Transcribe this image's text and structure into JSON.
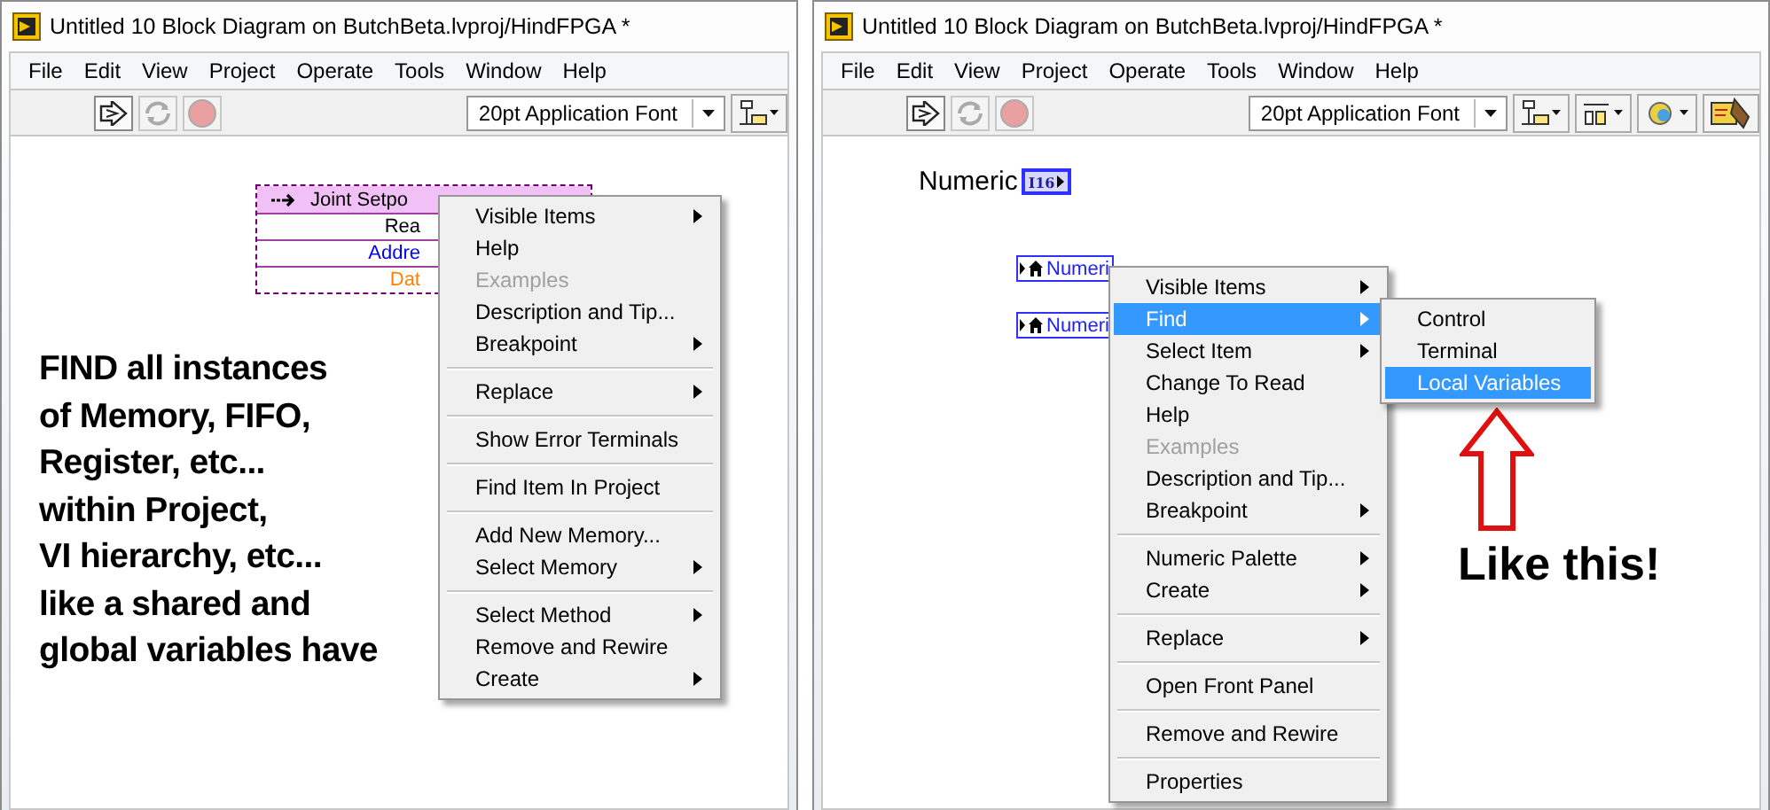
{
  "windows": [
    {
      "title": "Untitled 10 Block Diagram on ButchBeta.lvproj/HindFPGA *",
      "menu_bar": [
        "File",
        "Edit",
        "View",
        "Project",
        "Operate",
        "Tools",
        "Window",
        "Help"
      ],
      "toolbar": {
        "buttons": [
          {
            "kind": "run",
            "disabled": false
          },
          {
            "kind": "run-continuous",
            "disabled": true
          },
          {
            "kind": "abort",
            "disabled": true
          }
        ],
        "font": "20pt Application Font",
        "tools": [
          {
            "kind": "align"
          }
        ]
      },
      "diagram": [
        {
          "kind": "node",
          "header": "Joint Setpo",
          "rows": [
            {
              "text": "Rea",
              "color": "#000000"
            },
            {
              "text": "Addre",
              "color": "#0000ff"
            },
            {
              "text": "Dat",
              "color": "#ff8000"
            }
          ]
        }
      ],
      "context_menu": [
        {
          "kind": "item",
          "label": "Visible Items",
          "submenu": true,
          "disabled": false,
          "selected": false
        },
        {
          "kind": "item",
          "label": "Help",
          "submenu": false,
          "disabled": false,
          "selected": false
        },
        {
          "kind": "item",
          "label": "Examples",
          "submenu": false,
          "disabled": true,
          "selected": false
        },
        {
          "kind": "item",
          "label": "Description and Tip...",
          "submenu": false,
          "disabled": false,
          "selected": false
        },
        {
          "kind": "item",
          "label": "Breakpoint",
          "submenu": true,
          "disabled": false,
          "selected": false
        },
        {
          "kind": "separator"
        },
        {
          "kind": "item",
          "label": "Replace",
          "submenu": true,
          "disabled": false,
          "selected": false
        },
        {
          "kind": "separator"
        },
        {
          "kind": "item",
          "label": "Show Error Terminals",
          "submenu": false,
          "disabled": false,
          "selected": false
        },
        {
          "kind": "separator"
        },
        {
          "kind": "item",
          "label": "Find Item In Project",
          "submenu": false,
          "disabled": false,
          "selected": false
        },
        {
          "kind": "separator"
        },
        {
          "kind": "item",
          "label": "Add New Memory...",
          "submenu": false,
          "disabled": false,
          "selected": false
        },
        {
          "kind": "item",
          "label": "Select Memory",
          "submenu": true,
          "disabled": false,
          "selected": false
        },
        {
          "kind": "separator"
        },
        {
          "kind": "item",
          "label": "Select Method",
          "submenu": true,
          "disabled": false,
          "selected": false
        },
        {
          "kind": "item",
          "label": "Remove and Rewire",
          "submenu": false,
          "disabled": false,
          "selected": false
        },
        {
          "kind": "item",
          "label": "Create",
          "submenu": true,
          "disabled": false,
          "selected": false
        }
      ],
      "annotation": {
        "kind": "note",
        "lines": [
          "FIND all instances",
          "of Memory, FIFO,",
          "Register, etc...",
          "within Project,",
          "VI hierarchy, etc...",
          "like a shared and",
          "global variables have"
        ]
      }
    },
    {
      "title": "Untitled 10 Block Diagram on ButchBeta.lvproj/HindFPGA *",
      "menu_bar": [
        "File",
        "Edit",
        "View",
        "Project",
        "Operate",
        "Tools",
        "Window",
        "Help"
      ],
      "toolbar": {
        "buttons": [
          {
            "kind": "run",
            "disabled": false
          },
          {
            "kind": "run-continuous",
            "disabled": true
          },
          {
            "kind": "abort",
            "disabled": true
          }
        ],
        "font": "20pt Application Font",
        "tools": [
          {
            "kind": "align"
          },
          {
            "kind": "distribute"
          },
          {
            "kind": "reorder"
          },
          {
            "kind": "cleanup"
          }
        ]
      },
      "diagram": [
        {
          "kind": "terminal",
          "label": "Numeric",
          "type": "I16"
        },
        {
          "kind": "local",
          "label": "Numeri"
        },
        {
          "kind": "local",
          "label": "Numeri"
        }
      ],
      "context_menu": [
        {
          "kind": "item",
          "label": "Visible Items",
          "submenu": true,
          "disabled": false,
          "selected": false
        },
        {
          "kind": "item",
          "label": "Find",
          "submenu": true,
          "disabled": false,
          "selected": true,
          "children": [
            {
              "kind": "item",
              "label": "Control",
              "submenu": false,
              "disabled": false,
              "selected": false
            },
            {
              "kind": "item",
              "label": "Terminal",
              "submenu": false,
              "disabled": false,
              "selected": false
            },
            {
              "kind": "item",
              "label": "Local Variables",
              "submenu": false,
              "disabled": false,
              "selected": true
            }
          ]
        },
        {
          "kind": "item",
          "label": "Select Item",
          "submenu": true,
          "disabled": false,
          "selected": false
        },
        {
          "kind": "item",
          "label": "Change To Read",
          "submenu": false,
          "disabled": false,
          "selected": false
        },
        {
          "kind": "item",
          "label": "Help",
          "submenu": false,
          "disabled": false,
          "selected": false
        },
        {
          "kind": "item",
          "label": "Examples",
          "submenu": false,
          "disabled": true,
          "selected": false
        },
        {
          "kind": "item",
          "label": "Description and Tip...",
          "submenu": false,
          "disabled": false,
          "selected": false
        },
        {
          "kind": "item",
          "label": "Breakpoint",
          "submenu": true,
          "disabled": false,
          "selected": false
        },
        {
          "kind": "separator"
        },
        {
          "kind": "item",
          "label": "Numeric Palette",
          "submenu": true,
          "disabled": false,
          "selected": false
        },
        {
          "kind": "item",
          "label": "Create",
          "submenu": true,
          "disabled": false,
          "selected": false
        },
        {
          "kind": "separator"
        },
        {
          "kind": "item",
          "label": "Replace",
          "submenu": true,
          "disabled": false,
          "selected": false
        },
        {
          "kind": "separator"
        },
        {
          "kind": "item",
          "label": "Open Front Panel",
          "submenu": false,
          "disabled": false,
          "selected": false
        },
        {
          "kind": "separator"
        },
        {
          "kind": "item",
          "label": "Remove and Rewire",
          "submenu": false,
          "disabled": false,
          "selected": false
        },
        {
          "kind": "separator"
        },
        {
          "kind": "item",
          "label": "Properties",
          "submenu": false,
          "disabled": false,
          "selected": false
        }
      ],
      "annotation": {
        "kind": "arrow-note",
        "lines": [
          "Like this!"
        ]
      }
    }
  ]
}
